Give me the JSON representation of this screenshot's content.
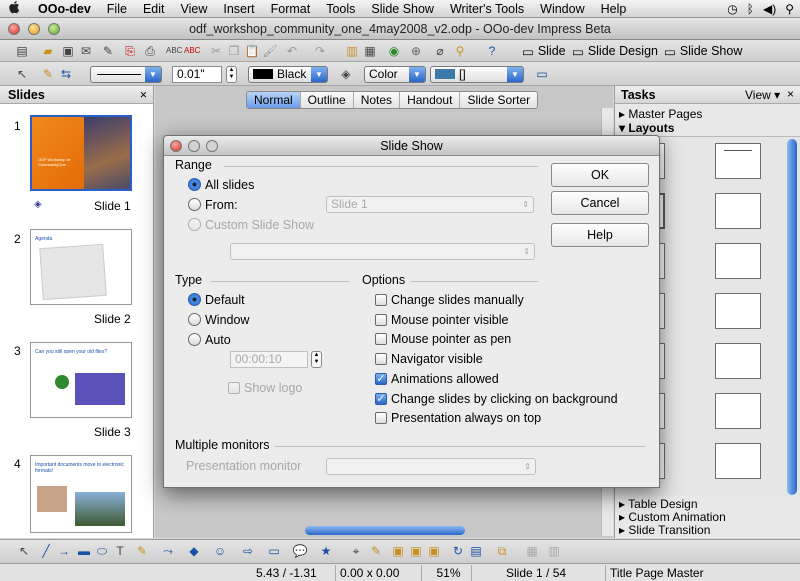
{
  "menubar": {
    "apple": "",
    "app": "OOo-dev",
    "items": [
      "File",
      "Edit",
      "View",
      "Insert",
      "Format",
      "Tools",
      "Slide Show",
      "Writer's Tools",
      "Window",
      "Help"
    ]
  },
  "window": {
    "title": "odf_workshop_community_one_4may2008_v2.odp - OOo-dev Impress Beta"
  },
  "toolbar1": {
    "slide_label": "Slide",
    "slide_design_label": "Slide Design",
    "slide_show_label": "Slide Show"
  },
  "toolbar2": {
    "line_width": "0.01\"",
    "line_color": "Black",
    "area_style": "Color",
    "area_fill": "[]"
  },
  "slides_panel": {
    "title": "Slides",
    "close": "×",
    "slides": [
      {
        "number": "1",
        "label": "Slide 1",
        "thumb_title": "ODF Workshop at CommunityOne"
      },
      {
        "number": "2",
        "label": "Slide 2",
        "thumb_title": "Agenda"
      },
      {
        "number": "3",
        "label": "Slide 3",
        "thumb_title": "Can you still open your old files?"
      },
      {
        "number": "4",
        "label": "",
        "thumb_title": "Important documents move to electronic formats!"
      }
    ]
  },
  "view_tabs": [
    "Normal",
    "Outline",
    "Notes",
    "Handout",
    "Slide Sorter"
  ],
  "tasks": {
    "title": "Tasks",
    "view": "View",
    "close": "×",
    "sections": {
      "master_pages": "Master Pages",
      "layouts": "Layouts",
      "table_design": "Table Design",
      "custom_animation": "Custom Animation",
      "slide_transition": "Slide Transition"
    }
  },
  "dialog": {
    "title": "Slide Show",
    "range": {
      "heading": "Range",
      "all_slides": "All slides",
      "from": "From:",
      "from_value": "Slide 1",
      "custom": "Custom Slide Show"
    },
    "type": {
      "heading": "Type",
      "default": "Default",
      "window": "Window",
      "auto": "Auto",
      "time": "00:00:10",
      "show_logo": "Show logo"
    },
    "options": {
      "heading": "Options",
      "items": [
        {
          "label": "Change slides manually",
          "checked": false
        },
        {
          "label": "Mouse pointer visible",
          "checked": false
        },
        {
          "label": "Mouse pointer as pen",
          "checked": false
        },
        {
          "label": "Navigator visible",
          "checked": false
        },
        {
          "label": "Animations allowed",
          "checked": true
        },
        {
          "label": "Change slides by clicking on background",
          "checked": true
        },
        {
          "label": "Presentation always on top",
          "checked": false
        }
      ]
    },
    "monitors": {
      "heading": "Multiple monitors",
      "presentation_monitor": "Presentation monitor"
    },
    "buttons": {
      "ok": "OK",
      "cancel": "Cancel",
      "help": "Help"
    }
  },
  "status": {
    "position": "5.43 / -1.31",
    "size": "0.00 x 0.00",
    "zoom": "51%",
    "slide": "Slide 1 / 54",
    "master": "Title Page Master"
  }
}
